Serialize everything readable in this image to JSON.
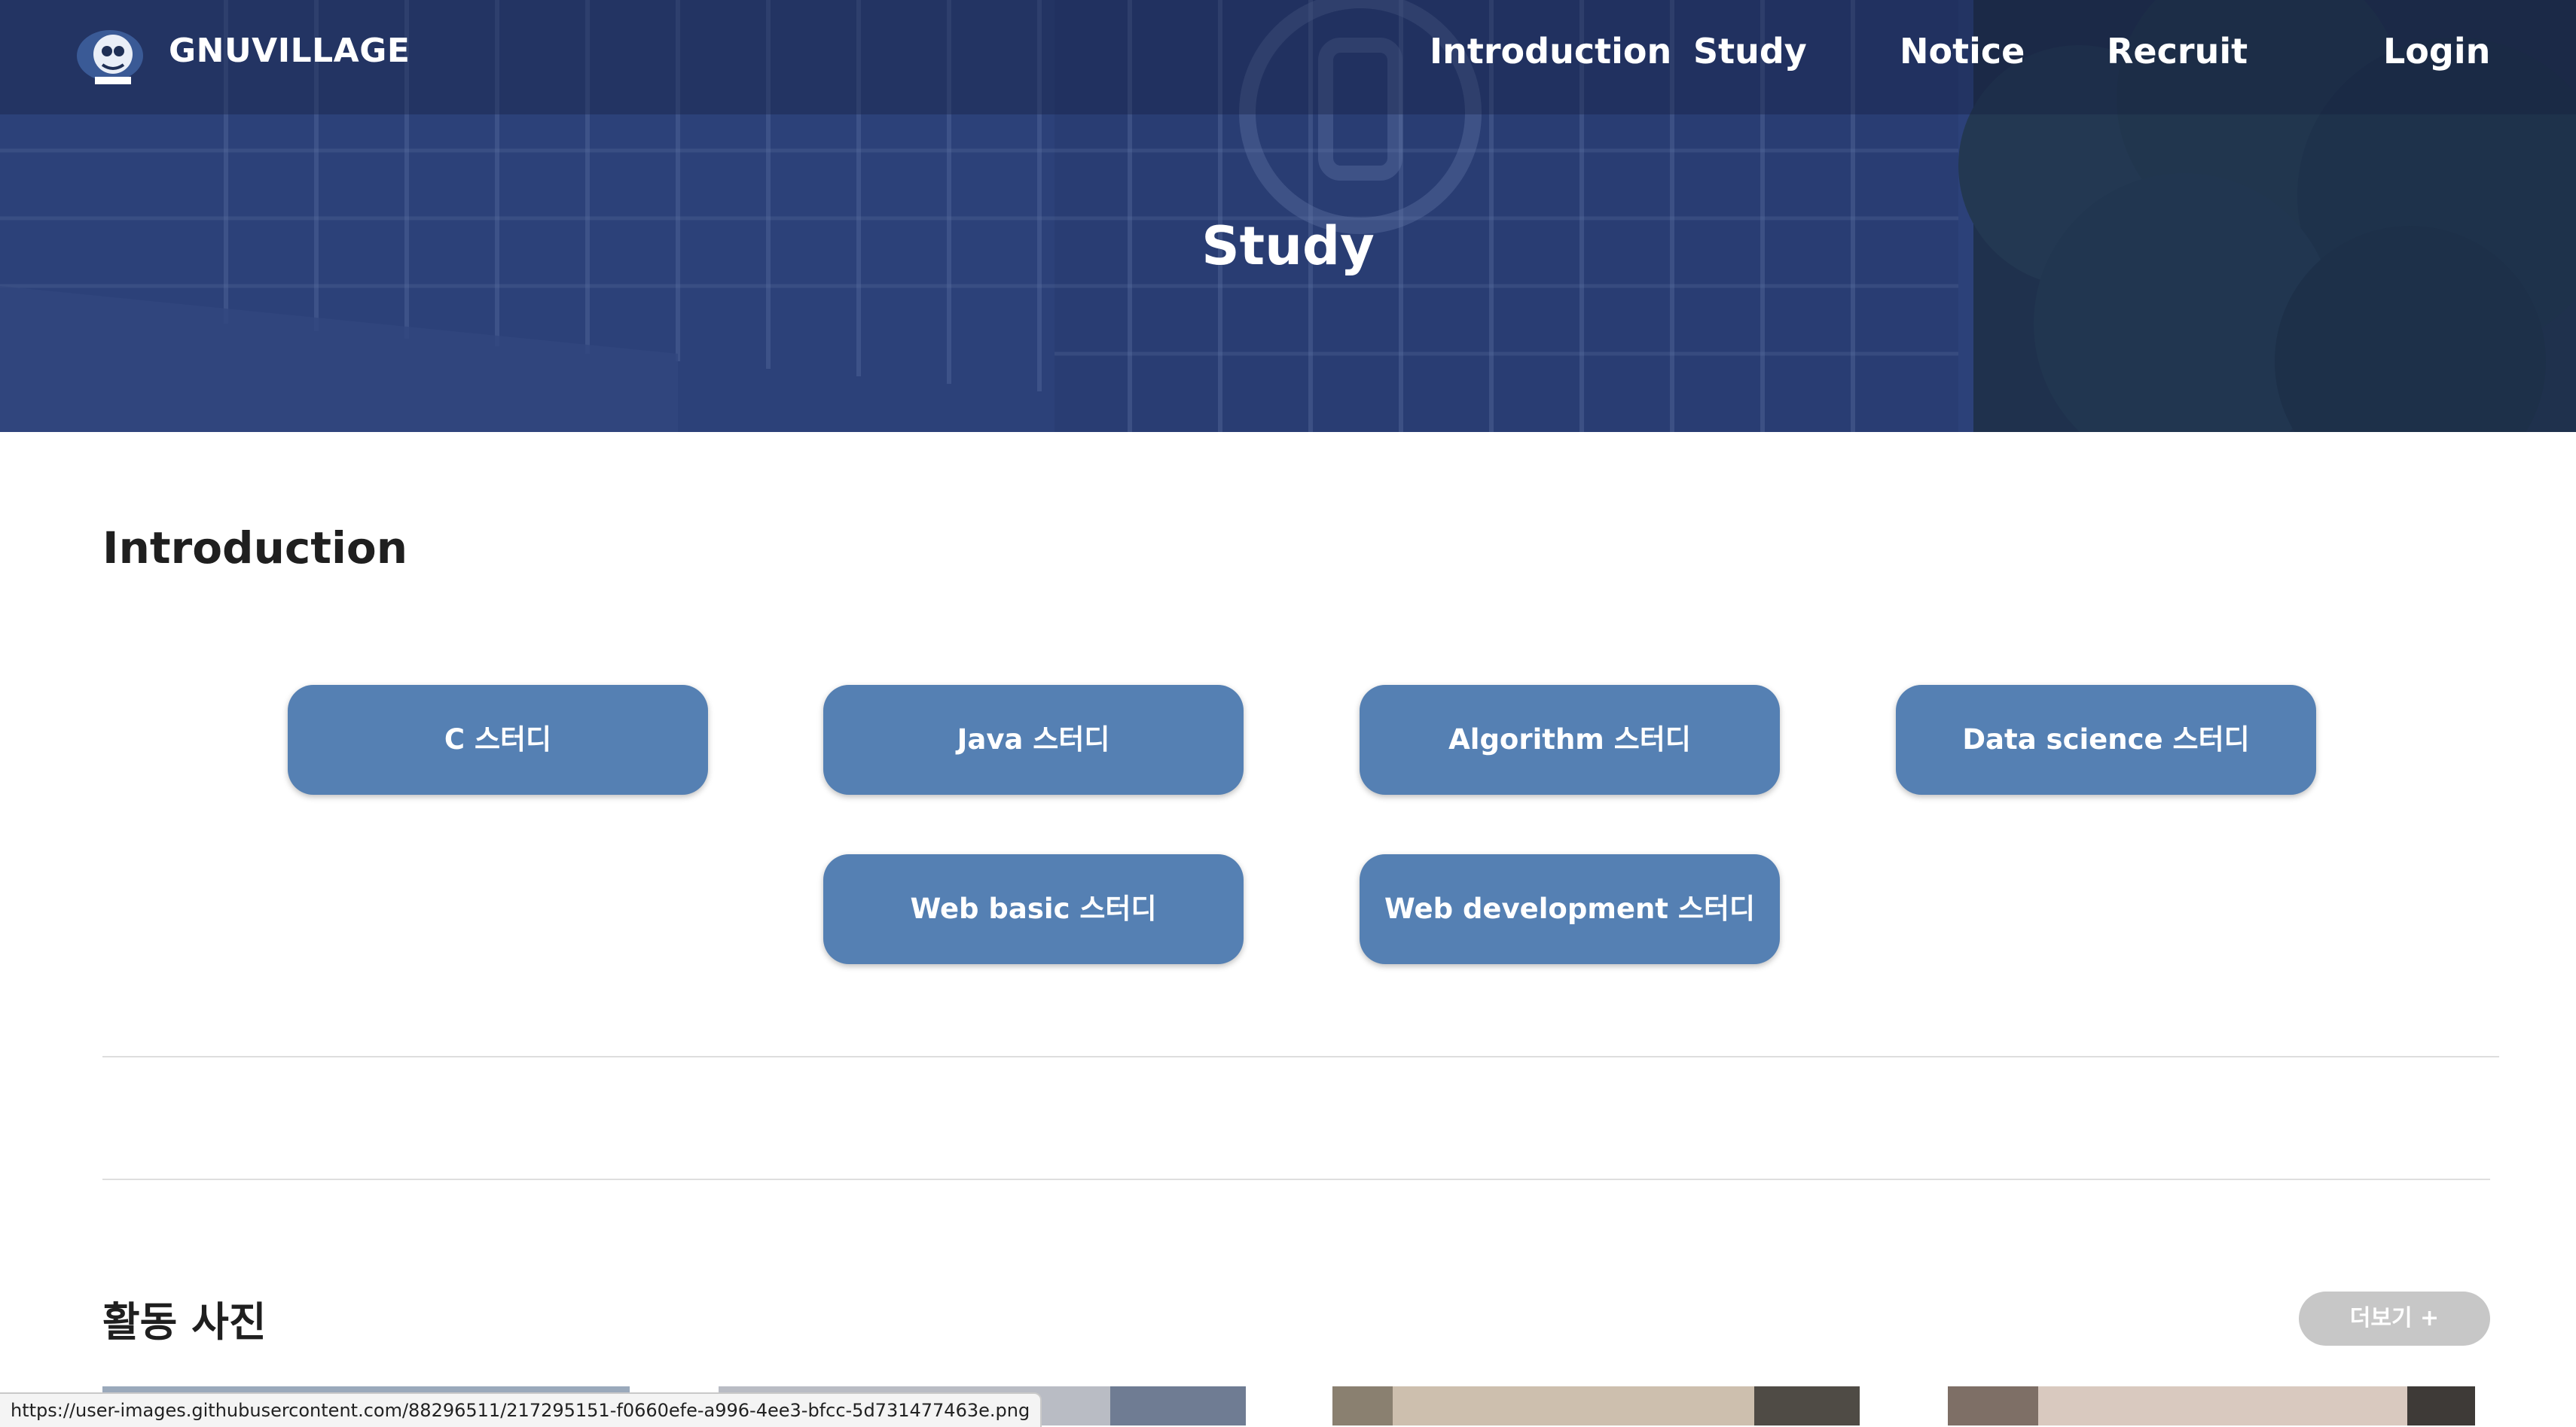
{
  "header": {
    "brand": "GNUVILLAGE",
    "nav": [
      "Introduction",
      "Study",
      "Notice",
      "Recruit",
      "Login"
    ]
  },
  "hero": {
    "title": "Study"
  },
  "intro": {
    "title": "Introduction",
    "studies": [
      "C 스터디",
      "Java 스터디",
      "Algorithm 스터디",
      "Data science 스터디",
      "Web basic 스터디",
      "Web development 스터디"
    ]
  },
  "photos": {
    "title": "활동 사진",
    "more_label": "더보기 +"
  },
  "status_bar": {
    "url": "https://user-images.githubusercontent.com/88296511/217295151-f0660efe-a996-4ee3-bfcc-5d731477463e.png"
  },
  "colors": {
    "button": "#5580b3",
    "hero_overlay": "#2b4080",
    "more_button": "#c7c7c7"
  },
  "icons": [
    "gnuvillage-logo-icon"
  ]
}
